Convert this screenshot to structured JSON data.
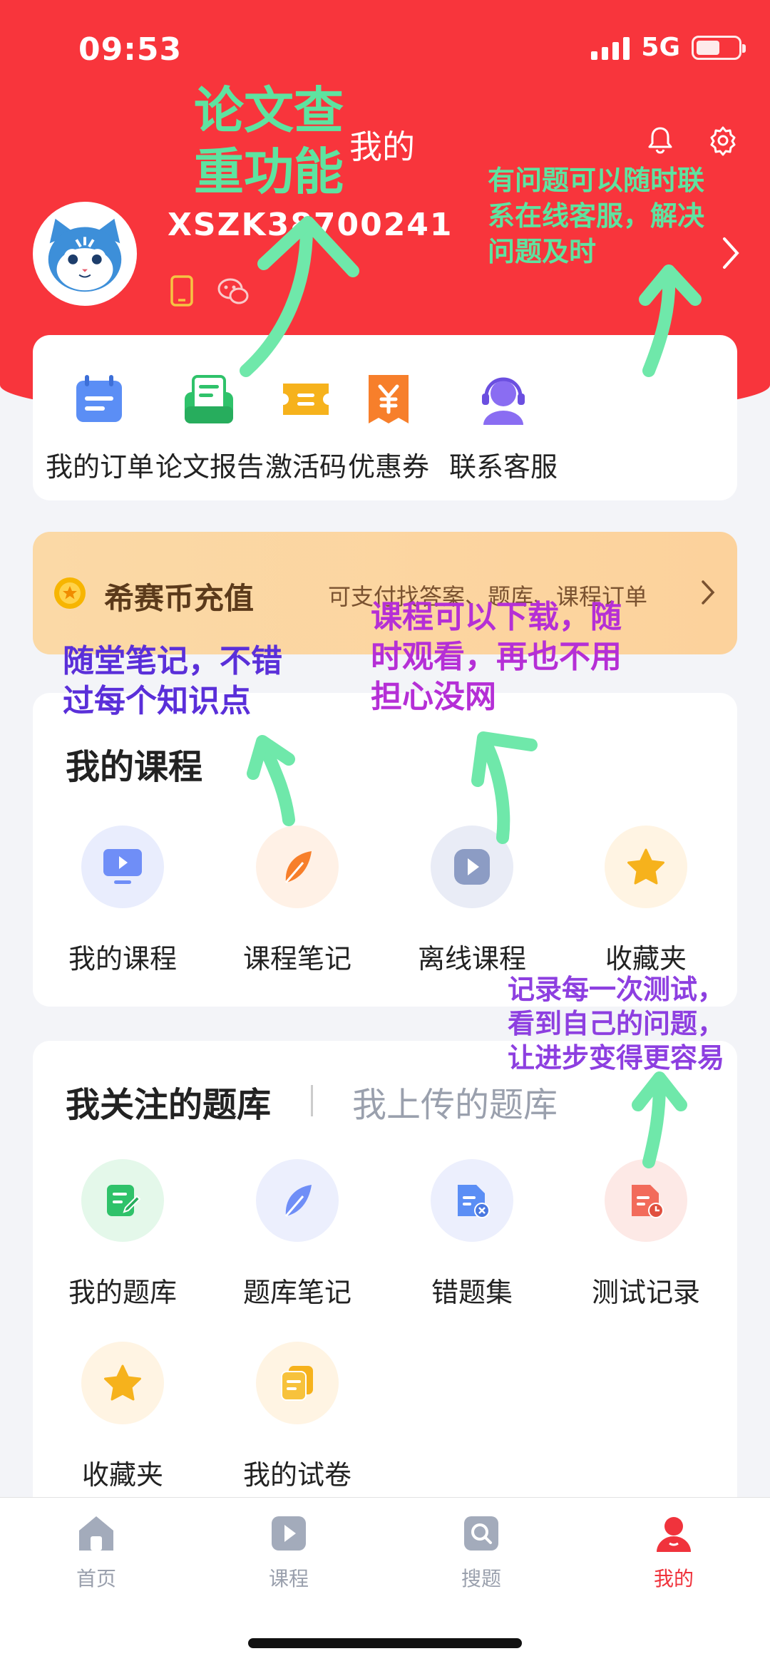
{
  "status": {
    "time": "09:53",
    "network": "5G"
  },
  "header": {
    "title": "我的",
    "username": "XSZK38700241"
  },
  "quick_actions": [
    {
      "label": "我的订单",
      "icon": "calendar-list-icon",
      "color": "#5b8ef5"
    },
    {
      "label": "论文报告",
      "icon": "paper-report-icon",
      "color": "#2fc26a"
    },
    {
      "label": "激活码",
      "icon": "ticket-icon",
      "color": "#f6b21c"
    },
    {
      "label": "优惠券",
      "icon": "coupon-yen-icon",
      "color": "#f77f2b"
    },
    {
      "label": "联系客服",
      "icon": "headset-agent-icon",
      "color": "#8a6df2"
    }
  ],
  "coin_banner": {
    "title": "希赛币充值",
    "desc": "可支付找答案、题库、课程订单"
  },
  "courses": {
    "title": "我的课程",
    "items": [
      {
        "label": "我的课程",
        "icon": "monitor-play-icon"
      },
      {
        "label": "课程笔记",
        "icon": "feather-icon"
      },
      {
        "label": "离线课程",
        "icon": "play-circle-icon"
      },
      {
        "label": "收藏夹",
        "icon": "star-icon"
      }
    ]
  },
  "banks": {
    "tab_active": "我关注的题库",
    "tab_inactive": "我上传的题库",
    "items": [
      {
        "label": "我的题库",
        "icon": "edit-doc-icon"
      },
      {
        "label": "题库笔记",
        "icon": "feather-icon"
      },
      {
        "label": "错题集",
        "icon": "doc-wrong-icon"
      },
      {
        "label": "测试记录",
        "icon": "doc-clock-icon"
      },
      {
        "label": "收藏夹",
        "icon": "star-icon"
      },
      {
        "label": "我的试卷",
        "icon": "papers-stack-icon"
      }
    ]
  },
  "tabbar": [
    {
      "label": "首页",
      "icon": "home-icon"
    },
    {
      "label": "课程",
      "icon": "play-icon"
    },
    {
      "label": "搜题",
      "icon": "search-icon"
    },
    {
      "label": "我的",
      "icon": "user-icon"
    }
  ],
  "annotations": {
    "paper_check": "论文查\n重功能",
    "service": "有问题可以随时联\n系在线客服，解决\n问题及时",
    "download": "课程可以下载，随\n时观看，再也不用\n担心没网",
    "notes": "随堂笔记，不错\n过每个知识点",
    "records": "记录每一次测试，\n看到自己的问题，\n让进步变得更容易"
  }
}
